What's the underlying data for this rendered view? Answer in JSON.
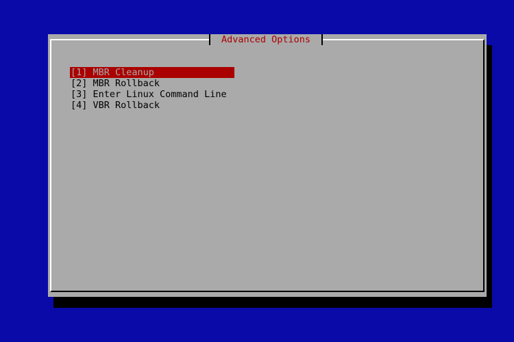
{
  "dialog": {
    "title": "Advanced Options",
    "title_color": "#aa0000",
    "background_color": "#aaaaaa",
    "selected_color": "#aa0000"
  },
  "screen": {
    "background_color": "#0a0aa8"
  },
  "menu": {
    "selected_index": 0,
    "items": [
      {
        "label": "[1] MBR Cleanup"
      },
      {
        "label": "[2] MBR Rollback"
      },
      {
        "label": "[3] Enter Linux Command Line"
      },
      {
        "label": "[4] VBR Rollback"
      }
    ]
  }
}
